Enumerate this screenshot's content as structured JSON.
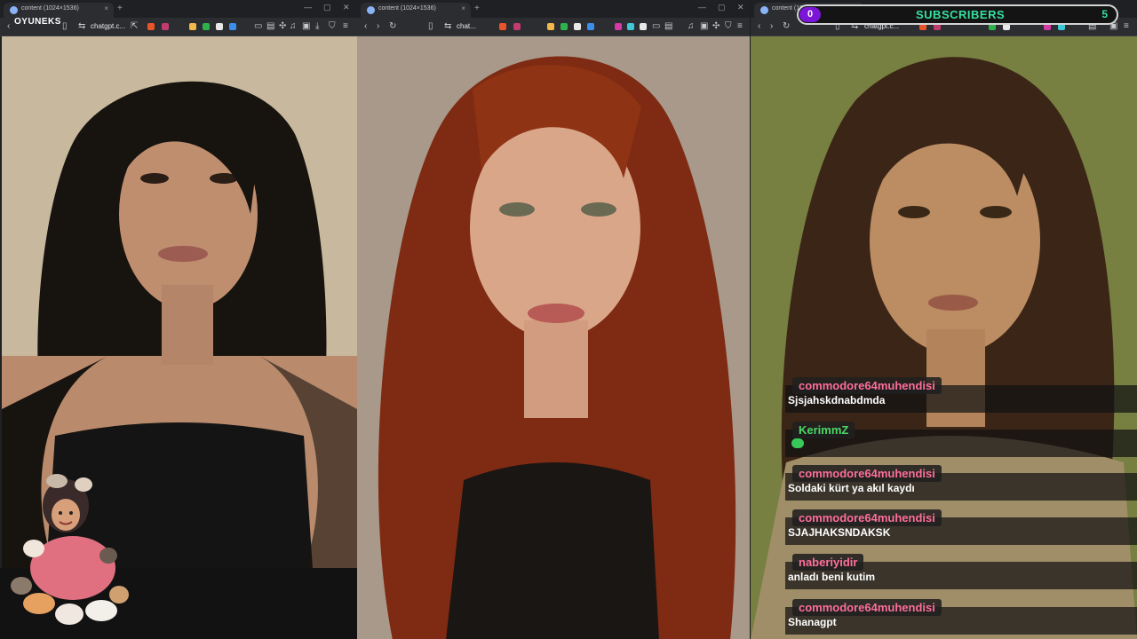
{
  "windows": [
    {
      "tab_title": "content (1024×1536)",
      "url_short": "chatgpt.c...",
      "photo_colors": {
        "bg": "#c9b9a0",
        "hair": "#1a1614",
        "skin": "#b98a6c",
        "top": "#151515"
      }
    },
    {
      "tab_title": "content (1024×1536)",
      "url_short": "chat...",
      "photo_colors": {
        "bg": "#a89a86",
        "hair": "#8a2d12",
        "skin": "#d8a487",
        "top": "#161413"
      }
    },
    {
      "tab_title": "content (1024×1536)",
      "url_short": "chatgpt.c...",
      "photo_colors": {
        "bg": "#6f7a3e",
        "hair": "#3a2416",
        "skin": "#b98a62",
        "top": "#9c8a63"
      }
    }
  ],
  "overlay": {
    "logo_text": "OYUNEKS",
    "subscribers": {
      "left_count": "0",
      "label": "SUBSCRIBERS",
      "right_count": "5"
    }
  },
  "chat": [
    {
      "user": "commodore64muhendisi",
      "user_color": "#ff6f9a",
      "text": "Sjsjahskdnabdmda"
    },
    {
      "user": "KerimmZ",
      "user_color": "#4cd964",
      "text": "",
      "emote": "green-emote"
    },
    {
      "user": "commodore64muhendisi",
      "user_color": "#ff6f9a",
      "text": "Soldaki kürt ya akıl kaydı"
    },
    {
      "user": "commodore64muhendisi",
      "user_color": "#ff6f9a",
      "text": "SJAJHAKSNDAKSK"
    },
    {
      "user": "naberiyidir",
      "user_color": "#ff6f9a",
      "text": "anladı beni kutim"
    },
    {
      "user": "commodore64muhendisi",
      "user_color": "#ff6f9a",
      "text": "Shanagpt"
    }
  ]
}
